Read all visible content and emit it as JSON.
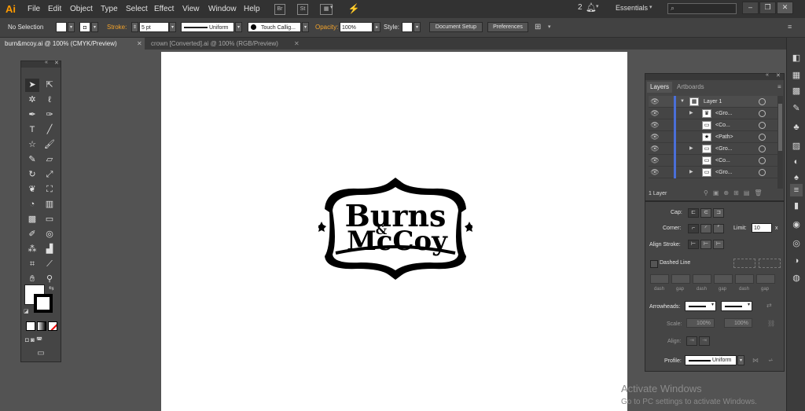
{
  "app": {
    "logo": "Ai"
  },
  "menu": [
    "File",
    "Edit",
    "Object",
    "Type",
    "Select",
    "Effect",
    "View",
    "Window",
    "Help"
  ],
  "menubar_right": {
    "notif_count": "2",
    "workspace": "Essentials",
    "search_placeholder": ""
  },
  "control_bar": {
    "selection": "No Selection",
    "stroke_label": "Stroke:",
    "stroke_value": "5 pt",
    "profile": "Uniform",
    "brush": "Touch Callig...",
    "opacity_label": "Opacity:",
    "opacity_value": "100%",
    "style_label": "Style:",
    "document_setup": "Document Setup",
    "preferences": "Preferences"
  },
  "tabs": [
    {
      "label": "burn&mcoy.ai @ 100% (CMYK/Preview)",
      "active": true
    },
    {
      "label": "crown [Converted].ai @ 100% (RGB/Preview)",
      "active": false
    }
  ],
  "artwork": {
    "line1": "Burns",
    "amp": "&",
    "line2": "McCoy"
  },
  "layers_panel": {
    "tabs": [
      "Layers",
      "Artboards"
    ],
    "rows": [
      {
        "name": "Layer 1",
        "thumb": "▦"
      },
      {
        "name": "<Gro...",
        "thumb": "♛"
      },
      {
        "name": "<Co...",
        "thumb": "▭"
      },
      {
        "name": "<Path>",
        "thumb": "★"
      },
      {
        "name": "<Gro...",
        "thumb": "▭"
      },
      {
        "name": "<Co...",
        "thumb": "▭"
      },
      {
        "name": "<Gro...",
        "thumb": "▭"
      }
    ],
    "footer": "1 Layer"
  },
  "stroke_panel": {
    "cap": "Cap:",
    "corner": "Corner:",
    "limit_label": "Limit:",
    "limit_value": "10",
    "limit_unit": "x",
    "align_stroke": "Align Stroke:",
    "dashed_line": "Dashed Line",
    "dash_labels": [
      "dash",
      "gap",
      "dash",
      "gap",
      "dash",
      "gap"
    ],
    "arrowheads": "Arrowheads:",
    "scale": "Scale:",
    "scale_a": "100%",
    "scale_b": "100%",
    "align": "Align:",
    "profile": "Profile:",
    "profile_value": "Uniform"
  },
  "watermark": {
    "line1": "Activate Windows",
    "line2": "Go to PC settings to activate Windows."
  }
}
